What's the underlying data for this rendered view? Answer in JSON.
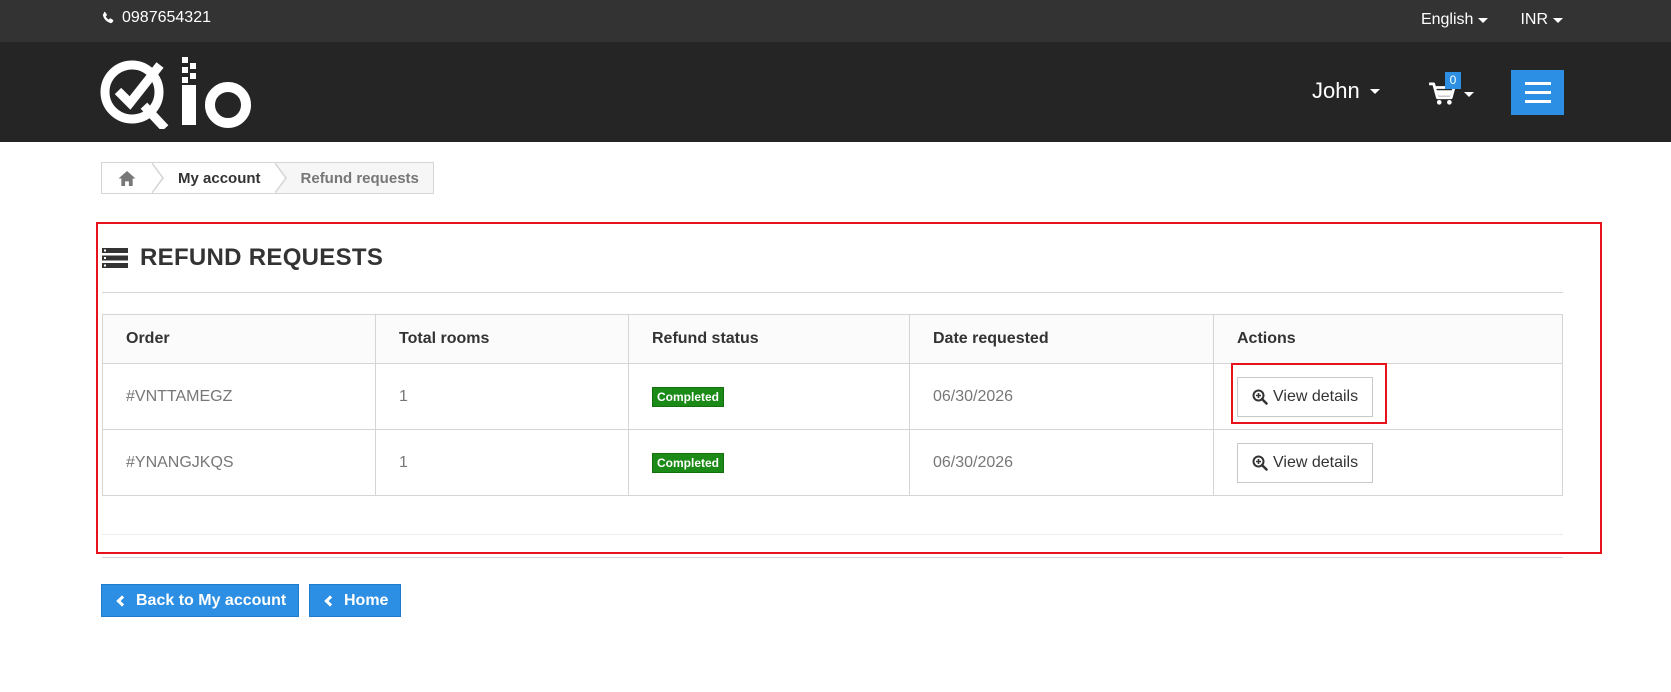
{
  "topbar": {
    "phone": "0987654321",
    "language": "English",
    "currency": "INR"
  },
  "header": {
    "user_name": "John",
    "cart_count": "0"
  },
  "breadcrumb": {
    "items": [
      "My account",
      "Refund requests"
    ]
  },
  "page": {
    "title": "REFUND REQUESTS"
  },
  "table": {
    "columns": [
      "Order",
      "Total rooms",
      "Refund status",
      "Date requested",
      "Actions"
    ],
    "rows": [
      {
        "order": "#VNTTAMEGZ",
        "rooms": "1",
        "status": "Completed",
        "date": "06/30/2026",
        "action": "View details"
      },
      {
        "order": "#YNANGJKQS",
        "rooms": "1",
        "status": "Completed",
        "date": "06/30/2026",
        "action": "View details"
      }
    ]
  },
  "buttons": {
    "back": "Back to My account",
    "home": "Home"
  },
  "colors": {
    "accent": "#2d8fe3",
    "status_completed": "#1c8a17",
    "highlight": "#e8121a"
  }
}
